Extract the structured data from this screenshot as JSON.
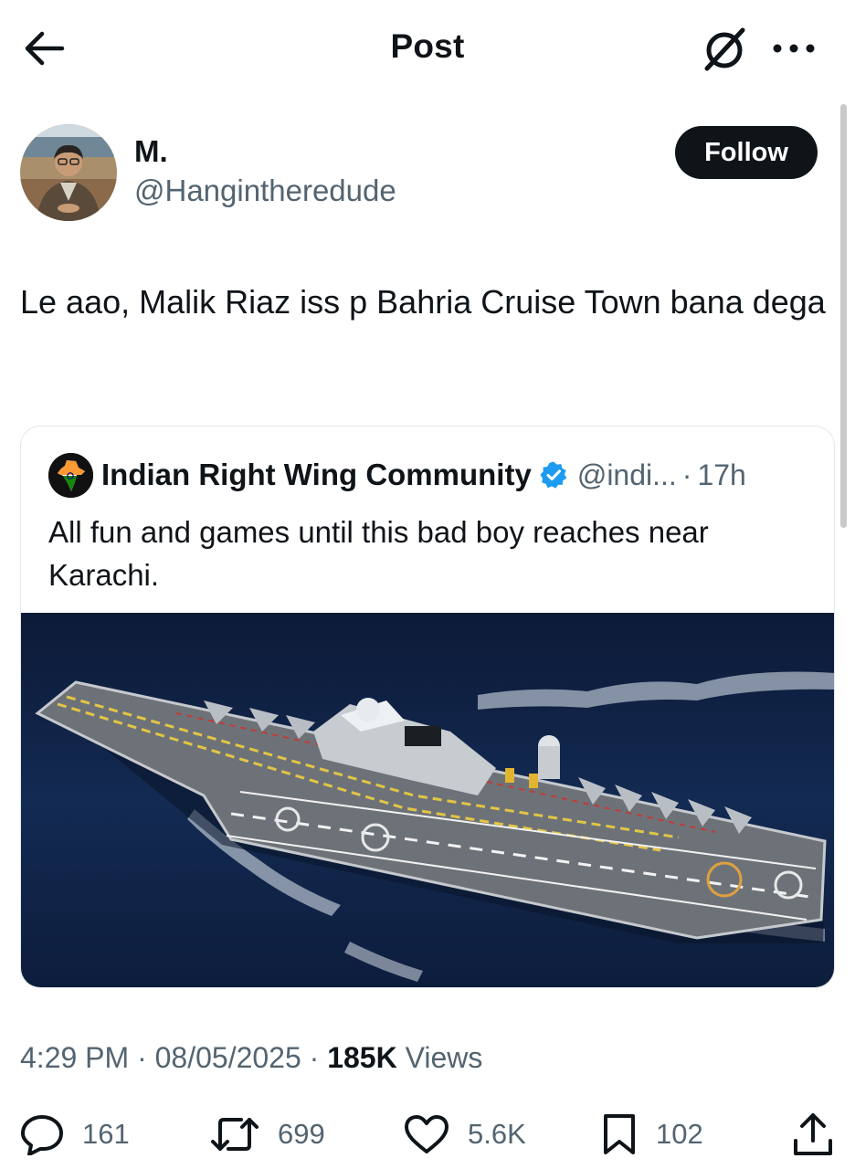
{
  "header": {
    "title": "Post",
    "icons": {
      "back": "arrow-left-icon",
      "grok": "grok-slash-icon",
      "more": "more-dots-icon"
    }
  },
  "post": {
    "author": {
      "name": "M.",
      "handle": "@Hangintheredude"
    },
    "follow_label": "Follow",
    "text": "Le aao, Malik Riaz iss p Bahria Cruise Town bana dega",
    "quote": {
      "author_name": "Indian Right Wing Community",
      "handle": "@indi...",
      "separator": "·",
      "time": "17h",
      "text": "All fun and games until this bad boy reaches near Karachi.",
      "verified_color": "#1d9bf0",
      "image_icon": "aircraft-carrier-photo"
    },
    "meta": {
      "time": "4:29 PM",
      "sep": "·",
      "date": "08/05/2025",
      "views_count": "185K",
      "views_label": "Views"
    },
    "actions": {
      "replies": "161",
      "reposts": "699",
      "likes": "5.6K",
      "bookmarks": "102"
    }
  },
  "colors": {
    "text": "#0f1419",
    "secondary": "#536471",
    "accent": "#1d9bf0",
    "border": "#e1e8ed"
  }
}
